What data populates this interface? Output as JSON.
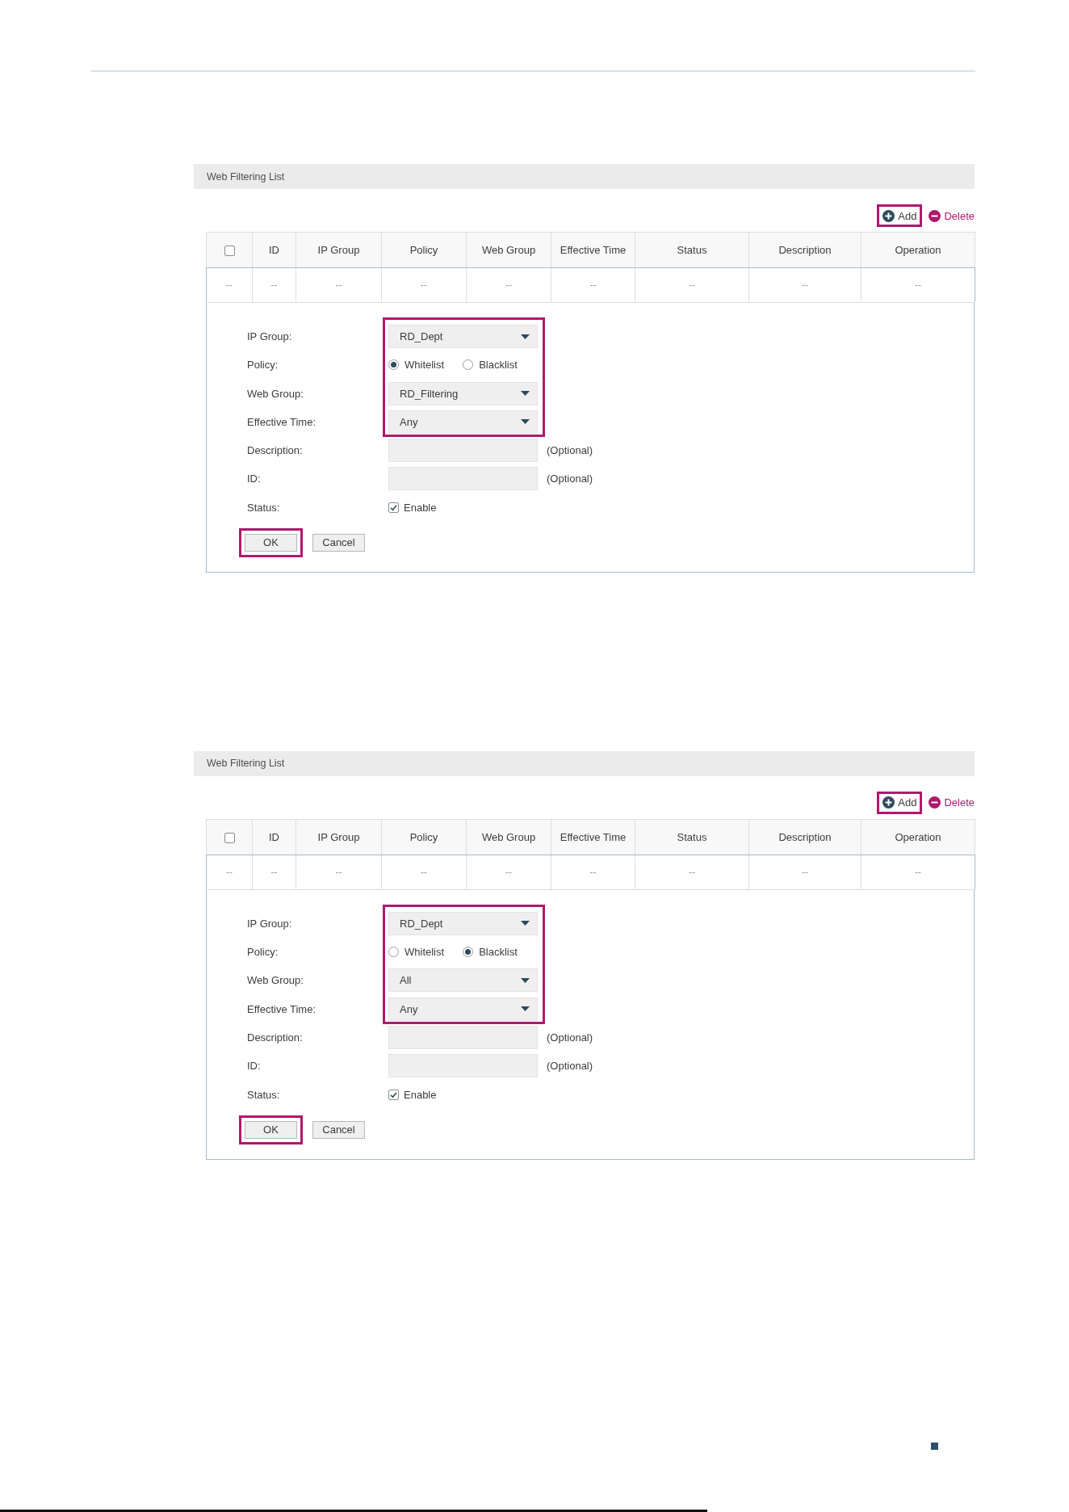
{
  "panels": [
    {
      "title": "Web Filtering List",
      "toolbar": [
        {
          "kind": "add",
          "label": "Add",
          "highlighted": true
        },
        {
          "kind": "delete",
          "label": "Delete",
          "highlighted": false
        }
      ],
      "table": {
        "columns": [
          {
            "kind": "checkbox",
            "checked": false
          },
          {
            "kind": "text",
            "label": "ID"
          },
          {
            "kind": "text",
            "label": "IP Group"
          },
          {
            "kind": "text",
            "label": "Policy"
          },
          {
            "kind": "text",
            "label": "Web Group"
          },
          {
            "kind": "text",
            "label": "Effective Time"
          },
          {
            "kind": "text",
            "label": "Status"
          },
          {
            "kind": "text",
            "label": "Description"
          },
          {
            "kind": "text",
            "label": "Operation"
          }
        ],
        "rows": [
          [
            "--",
            "--",
            "--",
            "--",
            "--",
            "--",
            "--",
            "--",
            "--"
          ]
        ]
      },
      "form": {
        "fields": [
          {
            "kind": "select",
            "label": "IP Group:",
            "value": "RD_Dept",
            "highlighted": true
          },
          {
            "kind": "radio",
            "label": "Policy:",
            "options": [
              {
                "label": "Whitelist",
                "selected": true
              },
              {
                "label": "Blacklist",
                "selected": false
              }
            ],
            "highlighted": true
          },
          {
            "kind": "select",
            "label": "Web Group:",
            "value": "RD_Filtering",
            "highlighted": true
          },
          {
            "kind": "select",
            "label": "Effective Time:",
            "value": "Any",
            "highlighted": true
          },
          {
            "kind": "text",
            "label": "Description:",
            "note": "(Optional)",
            "highlighted": false
          },
          {
            "kind": "text",
            "label": "ID:",
            "note": "(Optional)",
            "highlighted": false
          },
          {
            "kind": "checkbox",
            "label": "Status:",
            "option": "Enable",
            "checked": true,
            "highlighted": false
          }
        ],
        "buttons": [
          {
            "label": "OK",
            "highlighted": true
          },
          {
            "label": "Cancel",
            "highlighted": false
          }
        ]
      }
    },
    {
      "title": "Web Filtering List",
      "toolbar": [
        {
          "kind": "add",
          "label": "Add",
          "highlighted": true
        },
        {
          "kind": "delete",
          "label": "Delete",
          "highlighted": false
        }
      ],
      "table": {
        "columns": [
          {
            "kind": "checkbox",
            "checked": false
          },
          {
            "kind": "text",
            "label": "ID"
          },
          {
            "kind": "text",
            "label": "IP Group"
          },
          {
            "kind": "text",
            "label": "Policy"
          },
          {
            "kind": "text",
            "label": "Web Group"
          },
          {
            "kind": "text",
            "label": "Effective Time"
          },
          {
            "kind": "text",
            "label": "Status"
          },
          {
            "kind": "text",
            "label": "Description"
          },
          {
            "kind": "text",
            "label": "Operation"
          }
        ],
        "rows": [
          [
            "--",
            "--",
            "--",
            "--",
            "--",
            "--",
            "--",
            "--",
            "--"
          ]
        ]
      },
      "form": {
        "fields": [
          {
            "kind": "select",
            "label": "IP Group:",
            "value": "RD_Dept",
            "highlighted": true
          },
          {
            "kind": "radio",
            "label": "Policy:",
            "options": [
              {
                "label": "Whitelist",
                "selected": false
              },
              {
                "label": "Blacklist",
                "selected": true
              }
            ],
            "highlighted": true
          },
          {
            "kind": "select",
            "label": "Web Group:",
            "value": "All",
            "highlighted": true
          },
          {
            "kind": "select",
            "label": "Effective Time:",
            "value": "Any",
            "highlighted": true
          },
          {
            "kind": "text",
            "label": "Description:",
            "note": "(Optional)",
            "highlighted": false
          },
          {
            "kind": "text",
            "label": "ID:",
            "note": "(Optional)",
            "highlighted": false
          },
          {
            "kind": "checkbox",
            "label": "Status:",
            "option": "Enable",
            "checked": true,
            "highlighted": false
          }
        ],
        "buttons": [
          {
            "label": "OK",
            "highlighted": true
          },
          {
            "label": "Cancel",
            "highlighted": false
          }
        ]
      }
    }
  ]
}
